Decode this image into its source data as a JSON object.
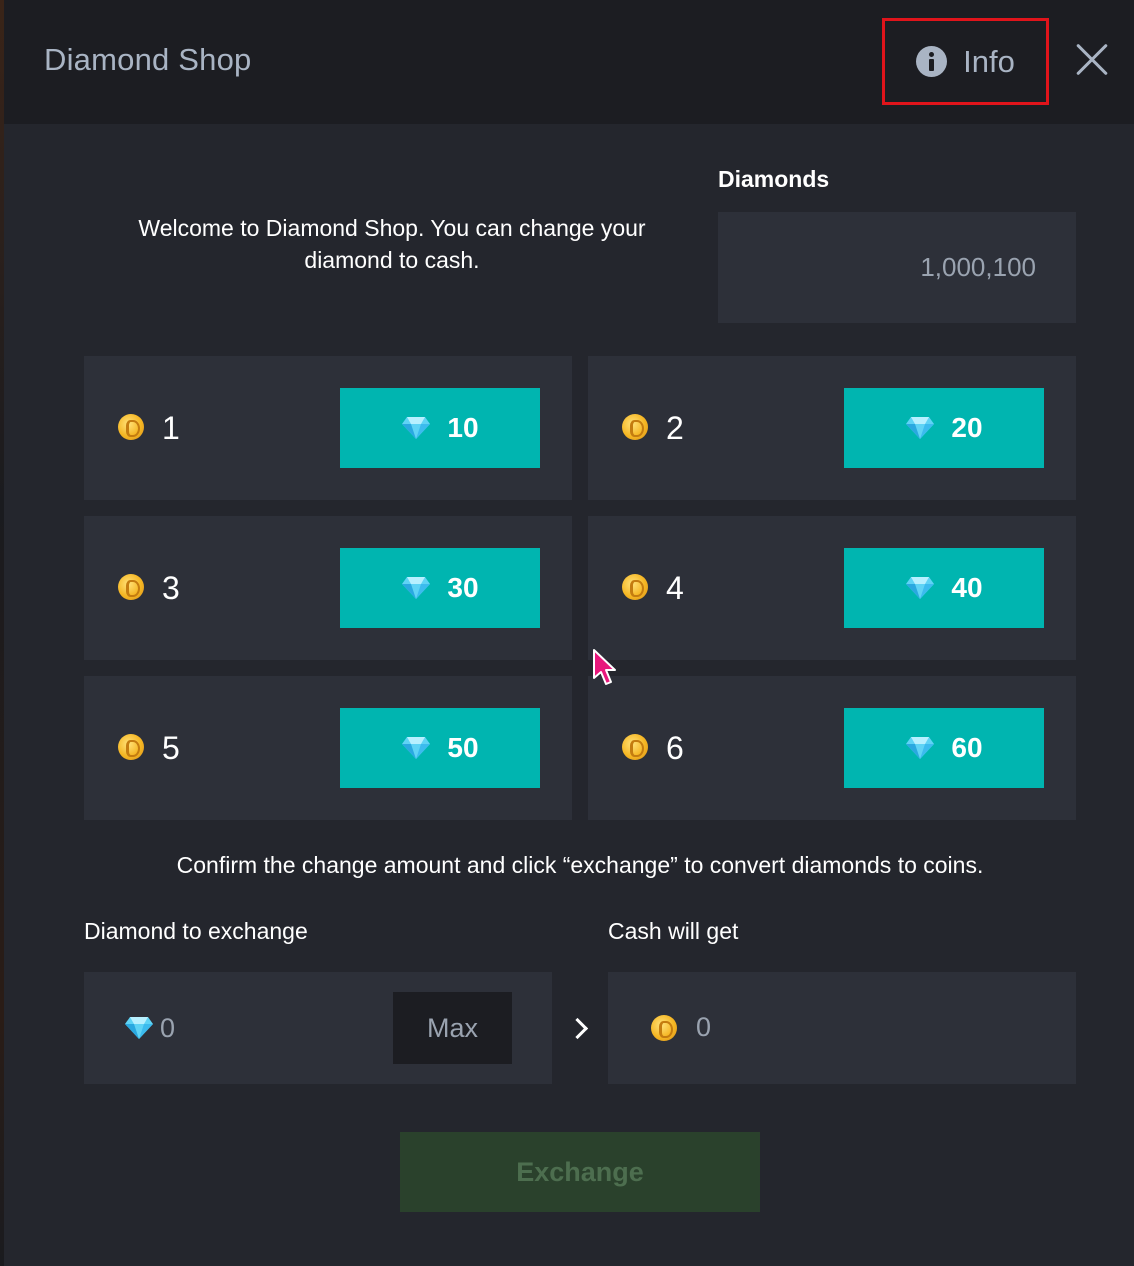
{
  "header": {
    "title": "Diamond Shop",
    "info_label": "Info"
  },
  "welcome_text": "Welcome to Diamond Shop. You can change your diamond to cash.",
  "balance": {
    "label": "Diamonds",
    "value": "1,000,100"
  },
  "packages": [
    {
      "coins": "1",
      "diamonds": "10"
    },
    {
      "coins": "2",
      "diamonds": "20"
    },
    {
      "coins": "3",
      "diamonds": "30"
    },
    {
      "coins": "4",
      "diamonds": "40"
    },
    {
      "coins": "5",
      "diamonds": "50"
    },
    {
      "coins": "6",
      "diamonds": "60"
    }
  ],
  "confirm_text": "Confirm the change amount and click “exchange” to convert diamonds to coins.",
  "exchange": {
    "diamond_label": "Diamond to exchange",
    "diamond_value": "0",
    "max_label": "Max",
    "cash_label": "Cash will get",
    "cash_value": "0",
    "button_label": "Exchange"
  },
  "colors": {
    "accent": "#00b5b0",
    "highlight_border": "#e0141b",
    "disabled_button": "#2a412c"
  },
  "icons": [
    "info-icon",
    "close-icon",
    "coin-icon",
    "diamond-icon",
    "chevron-right-icon",
    "cursor-icon"
  ]
}
